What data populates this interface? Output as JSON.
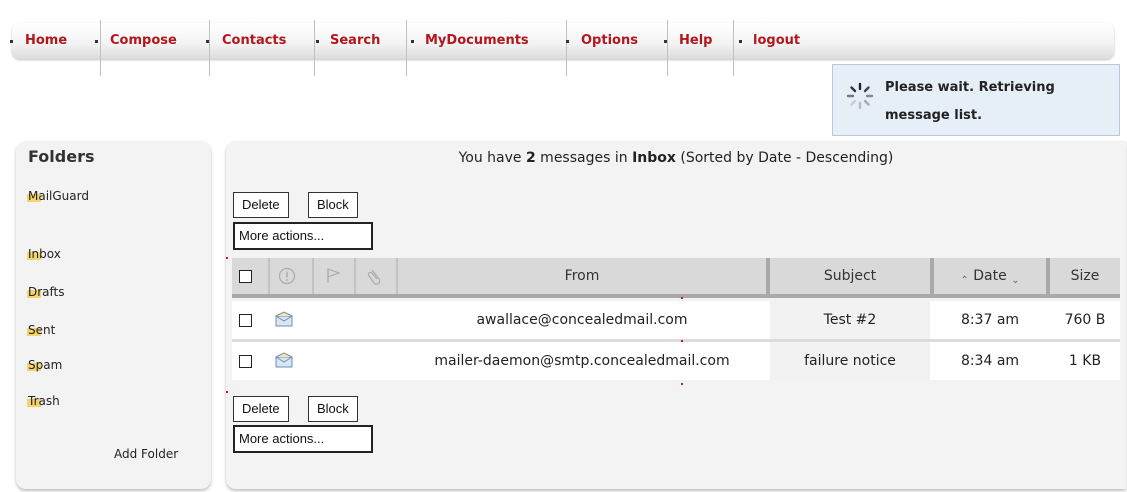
{
  "nav": {
    "items": [
      "Home",
      "Compose",
      "Contacts",
      "Search",
      "MyDocuments",
      "Options",
      "Help",
      "logout"
    ]
  },
  "status": {
    "message": "Please wait. Retrieving message list.",
    "icon": "spinner-icon"
  },
  "folders": {
    "title": "Folders",
    "items": [
      "MailGuard",
      "Inbox",
      "Drafts",
      "Sent",
      "Spam",
      "Trash"
    ],
    "add_label": "Add Folder"
  },
  "summary": {
    "prefix": "You have ",
    "count": "2",
    "middle": " messages in ",
    "folder": "Inbox",
    "suffix": " (Sorted by Date - Descending)"
  },
  "actions": {
    "delete_label": "Delete",
    "block_label": "Block",
    "more_actions": "More actions..."
  },
  "table": {
    "columns": [
      "From",
      "Subject",
      "Date",
      "Size"
    ],
    "rows": [
      {
        "from": "awallace@concealedmail.com",
        "subject": "Test #2",
        "date": "8:37 am",
        "size": "760 B"
      },
      {
        "from": "mailer-daemon@smtp.concealedmail.com",
        "subject": "failure notice",
        "date": "8:34 am",
        "size": "1 KB"
      }
    ]
  },
  "colors": {
    "nav_text": "#b3161c",
    "status_bg": "#e6eef8",
    "panel_bg": "#f3f3f3",
    "header_bg": "#d9d9d9",
    "folder_highlight": "#f3d36b"
  }
}
